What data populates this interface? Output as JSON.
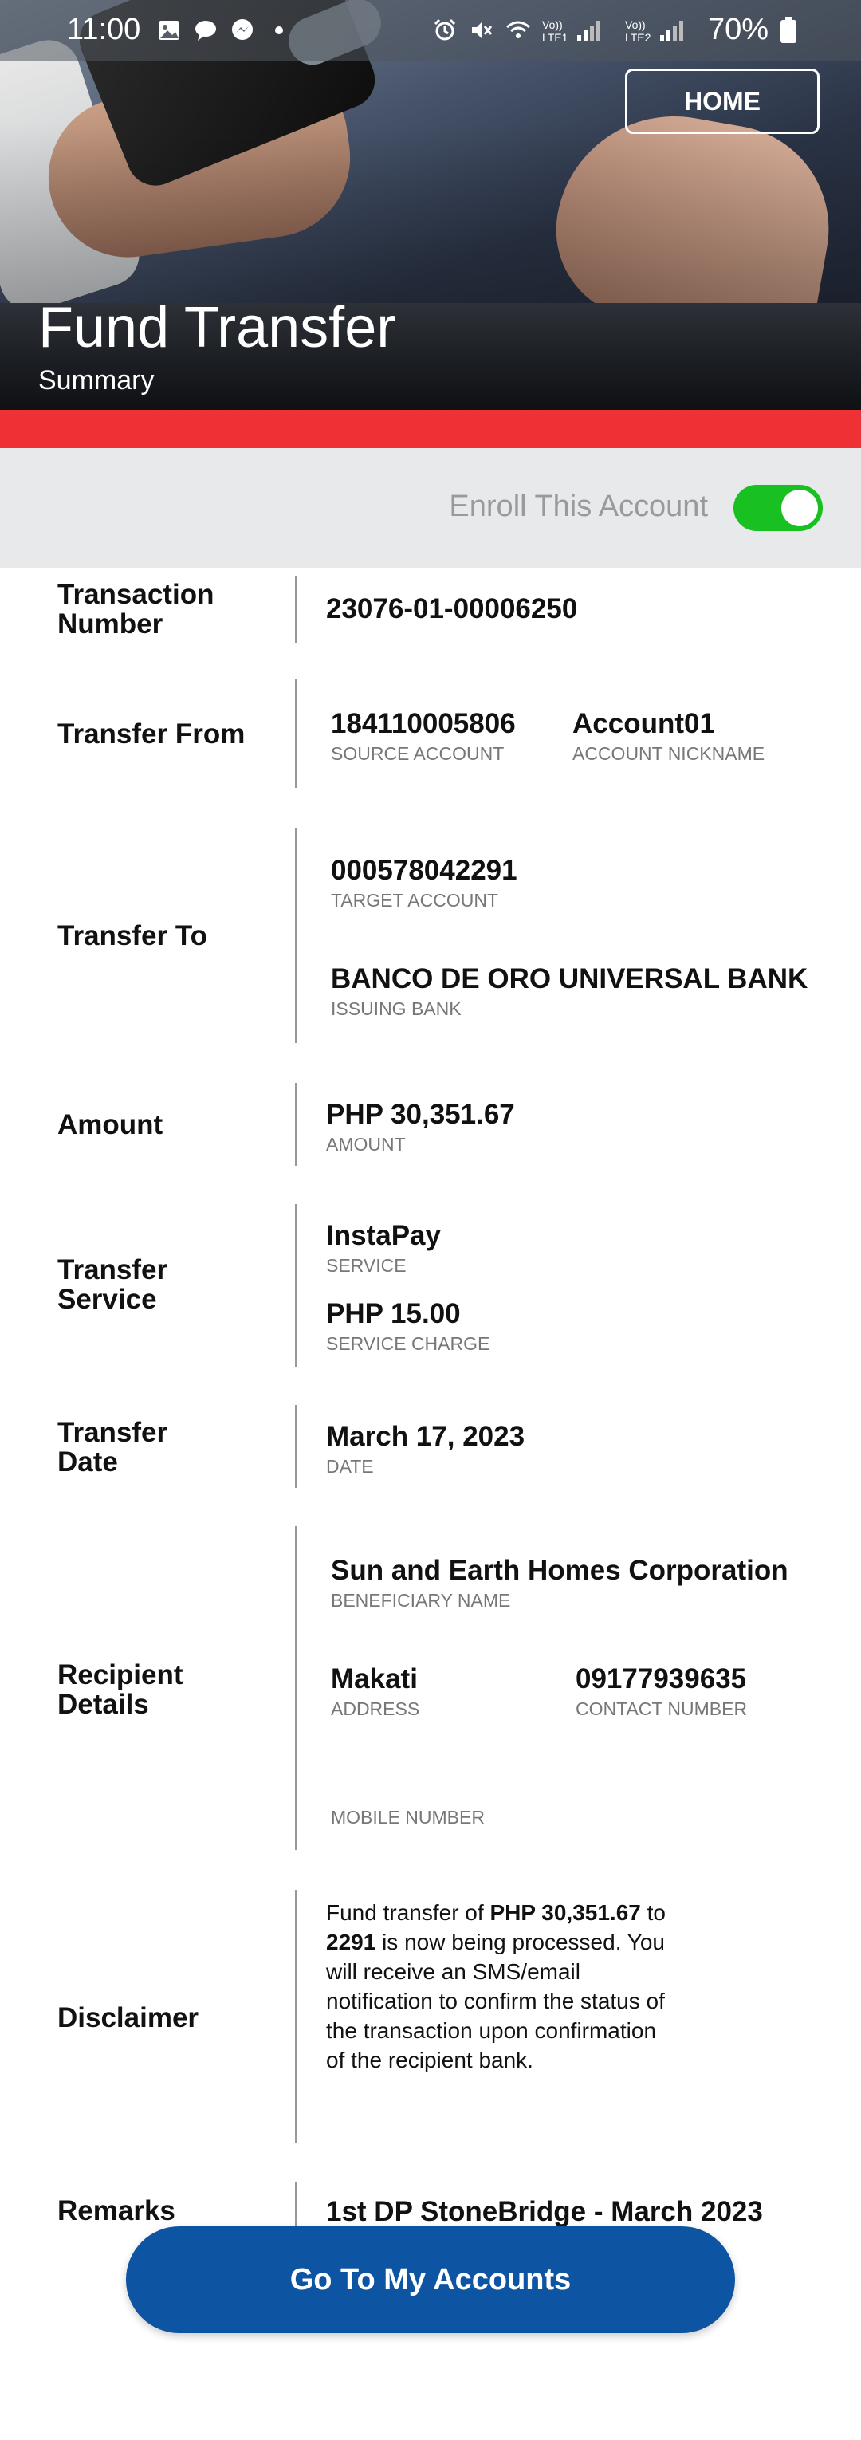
{
  "status_bar": {
    "time": "11:00",
    "battery": "70%",
    "network1": "LTE1",
    "network2": "LTE2"
  },
  "header": {
    "home_label": "HOME",
    "title": "Fund Transfer",
    "subtitle": "Summary"
  },
  "enroll": {
    "label": "Enroll This Account",
    "enabled": true,
    "accent": "#19c022"
  },
  "details": {
    "transaction_number": {
      "label": "Transaction Number",
      "value": "23076-01-00006250"
    },
    "transfer_from": {
      "label": "Transfer From",
      "account": "184110005806",
      "account_caption": "SOURCE ACCOUNT",
      "nickname": "Account01",
      "nickname_caption": "ACCOUNT NICKNAME"
    },
    "transfer_to": {
      "label": "Transfer To",
      "account": "000578042291",
      "account_caption": "TARGET ACCOUNT",
      "bank": "BANCO DE ORO UNIVERSAL BANK",
      "bank_caption": "ISSUING BANK"
    },
    "amount": {
      "label": "Amount",
      "value": "PHP 30,351.67",
      "caption": "AMOUNT"
    },
    "transfer_service": {
      "label": "Transfer Service",
      "service": "InstaPay",
      "service_caption": "SERVICE",
      "charge": "PHP 15.00",
      "charge_caption": "SERVICE CHARGE"
    },
    "transfer_date": {
      "label": "Transfer Date",
      "value": "March 17, 2023",
      "caption": "DATE"
    },
    "recipient": {
      "label": "Recipient Details",
      "name": "Sun and Earth Homes Corporation",
      "name_caption": "BENEFICIARY NAME",
      "address": "Makati",
      "address_caption": "ADDRESS",
      "contact": "09177939635",
      "contact_caption": "CONTACT NUMBER",
      "mobile": "",
      "mobile_caption": "MOBILE NUMBER"
    },
    "disclaimer": {
      "label": "Disclaimer",
      "prefix": "Fund transfer of ",
      "amount": "PHP 30,351.67",
      "mid": " to ",
      "target": "2291",
      "suffix": " is now being processed. You will receive an SMS/email notification to confirm the status of the transaction upon confirmation of the recipient bank."
    },
    "remarks": {
      "label": "Remarks",
      "value": "1st DP StoneBridge - March 2023"
    }
  },
  "footer": {
    "cta_label": "Go To My Accounts",
    "cta_color": "#0d54a3"
  },
  "colors": {
    "red_bar": "#ee3135"
  }
}
